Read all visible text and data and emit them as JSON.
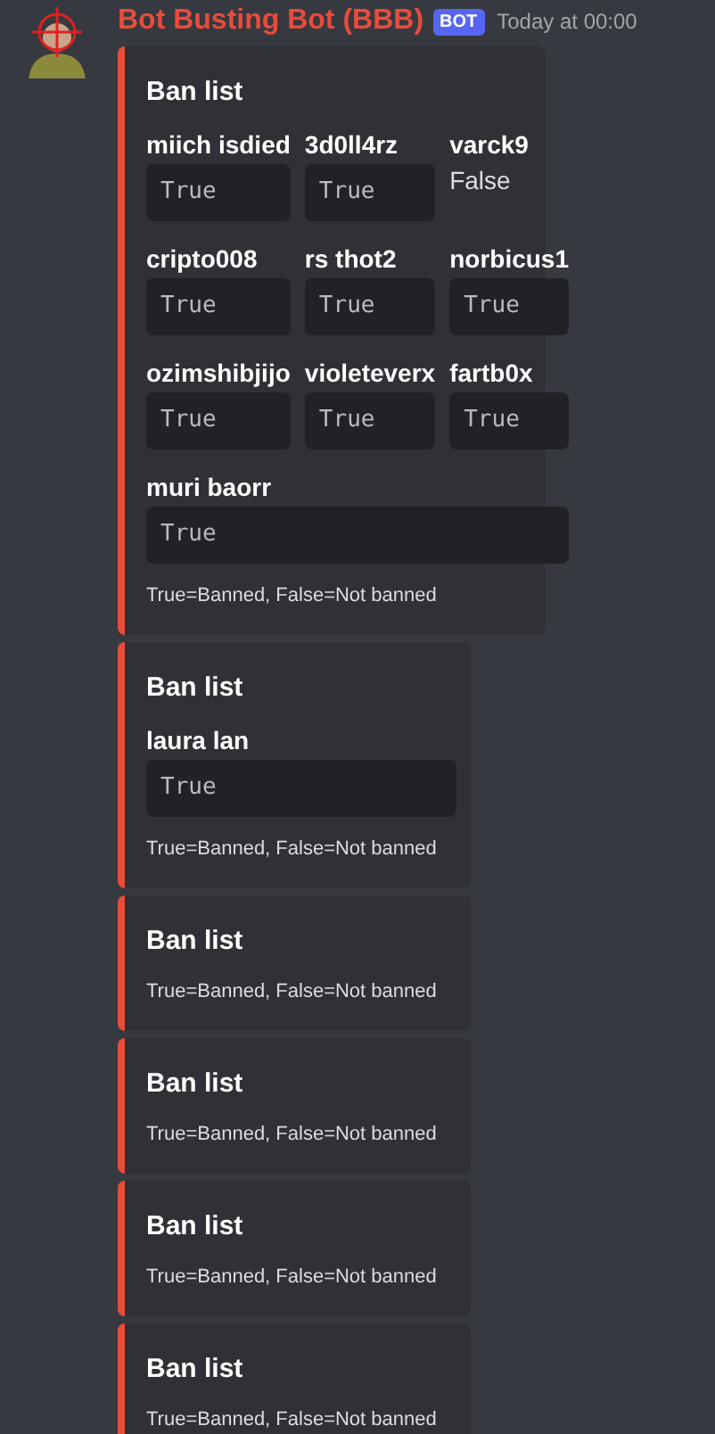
{
  "message": {
    "author": "Bot Busting Bot (BBB)",
    "badge": "BOT",
    "timestamp": "Today at 00:00"
  },
  "embeds": [
    {
      "title": "Ban list",
      "fields": [
        {
          "name": "miich isdied",
          "value": "True",
          "kind": "code"
        },
        {
          "name": "3d0ll4rz",
          "value": "True",
          "kind": "code"
        },
        {
          "name": "varck9",
          "value": "False",
          "kind": "text"
        },
        {
          "name": "cripto008",
          "value": "True",
          "kind": "code"
        },
        {
          "name": "rs thot2",
          "value": "True",
          "kind": "code"
        },
        {
          "name": "norbicus1",
          "value": "True",
          "kind": "code"
        },
        {
          "name": "ozimshibjijo",
          "value": "True",
          "kind": "code"
        },
        {
          "name": "violeteverx",
          "value": "True",
          "kind": "code"
        },
        {
          "name": "fartb0x",
          "value": "True",
          "kind": "code"
        },
        {
          "name": "muri baorr",
          "value": "True",
          "kind": "wide_code"
        }
      ],
      "footer": "True=Banned, False=Not banned"
    },
    {
      "title": "Ban list",
      "fields": [
        {
          "name": "laura lan",
          "value": "True",
          "kind": "wide_code"
        }
      ],
      "footer": "True=Banned, False=Not banned"
    },
    {
      "title": "Ban list",
      "footer": "True=Banned, False=Not banned"
    },
    {
      "title": "Ban list",
      "footer": "True=Banned, False=Not banned"
    },
    {
      "title": "Ban list",
      "footer": "True=Banned, False=Not banned"
    },
    {
      "title": "Ban list",
      "footer": "True=Banned, False=Not banned"
    }
  ]
}
